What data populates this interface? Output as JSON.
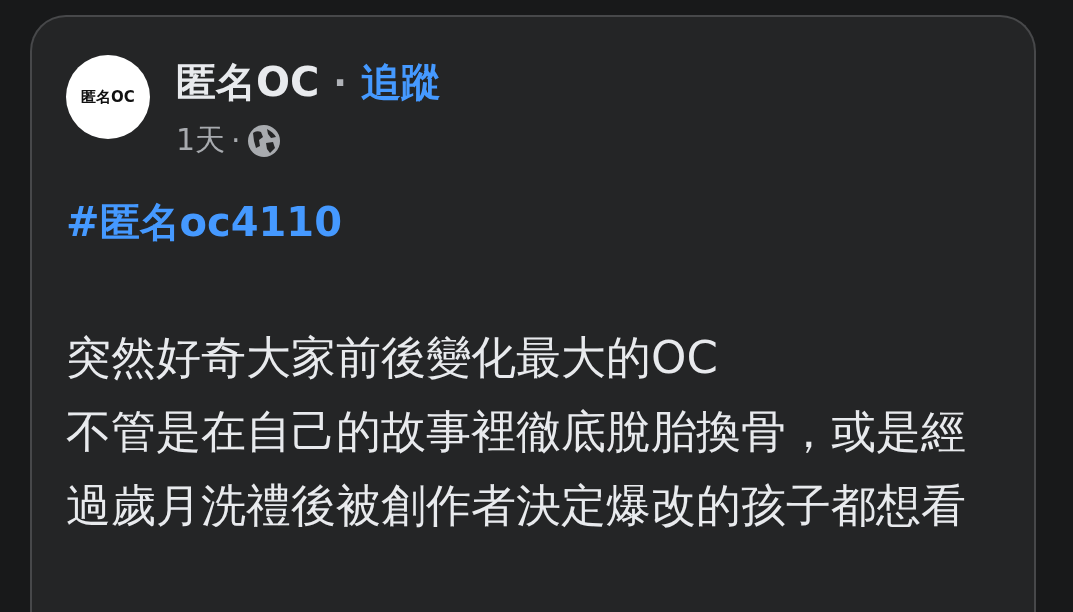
{
  "post": {
    "author": {
      "avatar_text": "匿名OC",
      "name": "匿名OC",
      "separator": "·",
      "follow": "追蹤",
      "time": "1天",
      "time_separator": "·"
    },
    "hashtag": "#匿名oc4110",
    "body_lines": [
      "突然好奇大家前後變化最大的OC",
      "不管是在自己的故事裡徹底脫胎換骨，或是經",
      "過歲月洗禮後被創作者決定爆改的孩子都想看"
    ]
  }
}
